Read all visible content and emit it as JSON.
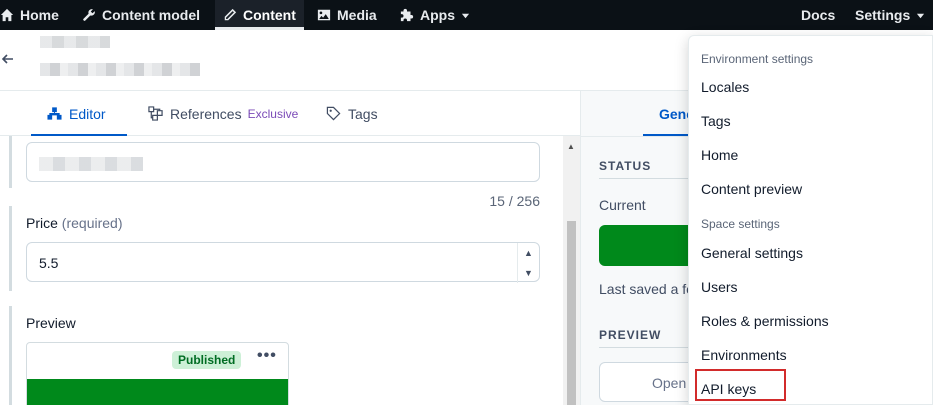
{
  "nav": {
    "items": [
      {
        "label": "Home",
        "icon": "home-icon"
      },
      {
        "label": "Content model",
        "icon": "wrench-icon"
      },
      {
        "label": "Content",
        "icon": "content-icon",
        "active": true
      },
      {
        "label": "Media",
        "icon": "image-icon"
      },
      {
        "label": "Apps",
        "icon": "puzzle-icon",
        "dropdown": true
      }
    ],
    "docs_label": "Docs",
    "settings_label": "Settings"
  },
  "editor_tabs": {
    "editor": "Editor",
    "references": "References",
    "references_badge": "Exclusive",
    "tags": "Tags"
  },
  "fields": {
    "title_counter": "15 / 256",
    "price_label": "Price",
    "price_required": "(required)",
    "price_value": "5.5",
    "preview_label": "Preview",
    "preview_badge": "Published",
    "preview_more": "•••"
  },
  "sidebar": {
    "tab_label": "Gene",
    "status_heading": "STATUS",
    "current_label": "Current",
    "last_saved": "Last saved a fe",
    "preview_heading": "PREVIEW",
    "open_label": "Open"
  },
  "settings_menu": {
    "environment_heading": "Environment settings",
    "environment_items": [
      "Locales",
      "Tags",
      "Home",
      "Content preview"
    ],
    "space_heading": "Space settings",
    "space_items": [
      "General settings",
      "Users",
      "Roles & permissions",
      "Environments",
      "API keys"
    ],
    "highlighted": "API keys"
  },
  "colors": {
    "nav_bg": "#0b1116",
    "accent_blue": "#0059c8",
    "publish_green": "#00891b",
    "highlight_red": "#d22b2b"
  }
}
